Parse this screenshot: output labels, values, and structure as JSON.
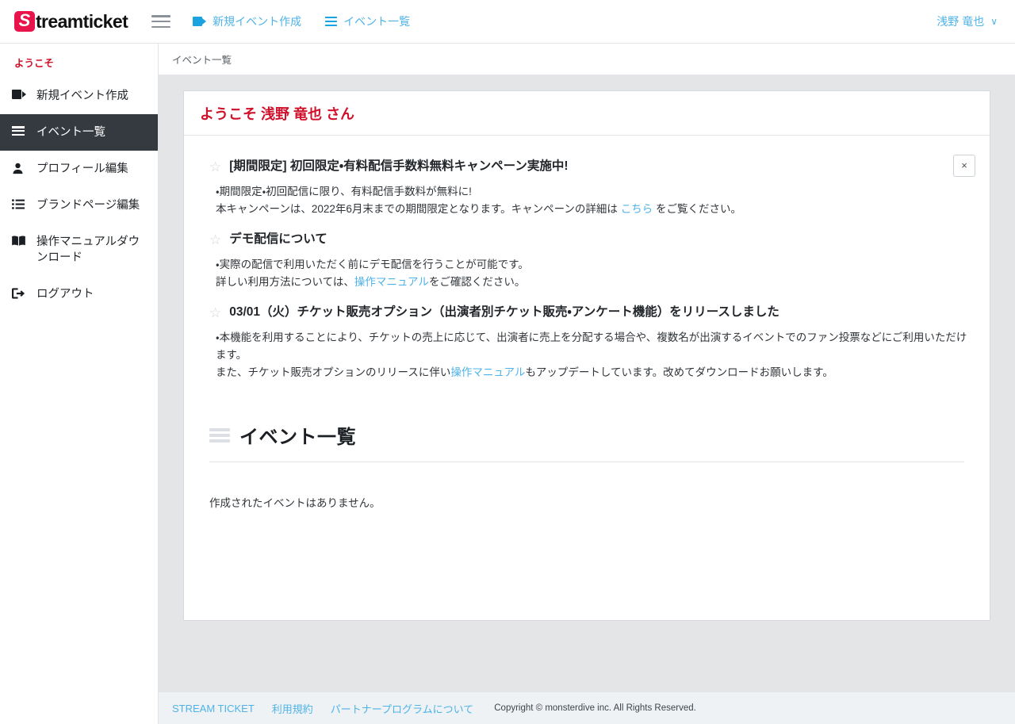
{
  "brand": {
    "logo_mark": "S",
    "logo_text": "treamticket",
    "logo_color": "#e8134a"
  },
  "topnav": {
    "menu_icon": "hamburger-icon",
    "items": [
      {
        "icon": "video-camera-icon",
        "label": "新規イベント作成"
      },
      {
        "icon": "list-icon",
        "label": "イベント一覧"
      }
    ],
    "user": {
      "name": "浅野 竜也",
      "caret": "∨"
    },
    "link_color": "#4fb3e8"
  },
  "sidebar": {
    "welcome_label": "ようこそ",
    "welcome_color": "#d0112b",
    "items": [
      {
        "icon": "video-camera-icon",
        "label": "新規イベント作成",
        "active": false
      },
      {
        "icon": "list-icon",
        "label": "イベント一覧",
        "active": true
      },
      {
        "icon": "user-icon",
        "label": "プロフィール編集",
        "active": false
      },
      {
        "icon": "list-ul-icon",
        "label": "ブランドページ編集",
        "active": false
      },
      {
        "icon": "book-icon",
        "label": "操作マニュアルダウンロード",
        "active": false
      },
      {
        "icon": "logout-icon",
        "label": "ログアウト",
        "active": false
      }
    ],
    "active_bg": "#343a40"
  },
  "breadcrumb": {
    "label": "イベント一覧"
  },
  "card": {
    "welcome_title": "ようこそ 浅野 竜也 さん",
    "welcome_color": "#d0112b"
  },
  "notices": [
    {
      "star_icon": "star-outline-icon",
      "title": "[期間限定] 初回限定・有料配信手数料無料キャンペーン実施中!",
      "line1": "・期間限定・初回配信に限り、有料配信手数料が無料に!",
      "line2_pre": "本キャンペーンは、2022年6月末までの期間限定となります。キャンペーンの詳細は ",
      "line2_link": "こちら",
      "line2_post": " をご覧ください。",
      "has_close": true,
      "close_label": "×"
    },
    {
      "star_icon": "star-outline-icon",
      "title": "デモ配信について",
      "line1": "・実際の配信で利用いただく前にデモ配信を行うことが可能です。",
      "line2_pre": "詳しい利用方法については、",
      "line2_link": "操作マニュアル",
      "line2_post": "をご確認ください。",
      "has_close": false,
      "close_label": ""
    },
    {
      "star_icon": "star-outline-icon",
      "title": "03/01（火）チケット販売オプション（出演者別チケット販売・アンケート機能）をリリースしました",
      "line1": "・本機能を利用することにより、チケットの売上に応じて、出演者に売上を分配する場合や、複数名が出演するイベントでのファン投票などにご利用いただけます。",
      "line2_pre": "また、チケット販売オプションのリリースに伴い",
      "line2_link": "操作マニュアル",
      "line2_post": "もアップデートしています。改めてダウンロードお願いします。",
      "has_close": false,
      "close_label": ""
    }
  ],
  "event_section": {
    "icon": "list-icon",
    "title": "イベント一覧",
    "empty_message": "作成されたイベントはありません。"
  },
  "footer": {
    "links": [
      "STREAM TICKET",
      "利用規約",
      "パートナープログラムについて"
    ],
    "copyright": "Copyright © monsterdive inc. All Rights Reserved.",
    "link_color": "#4fb3e8"
  }
}
